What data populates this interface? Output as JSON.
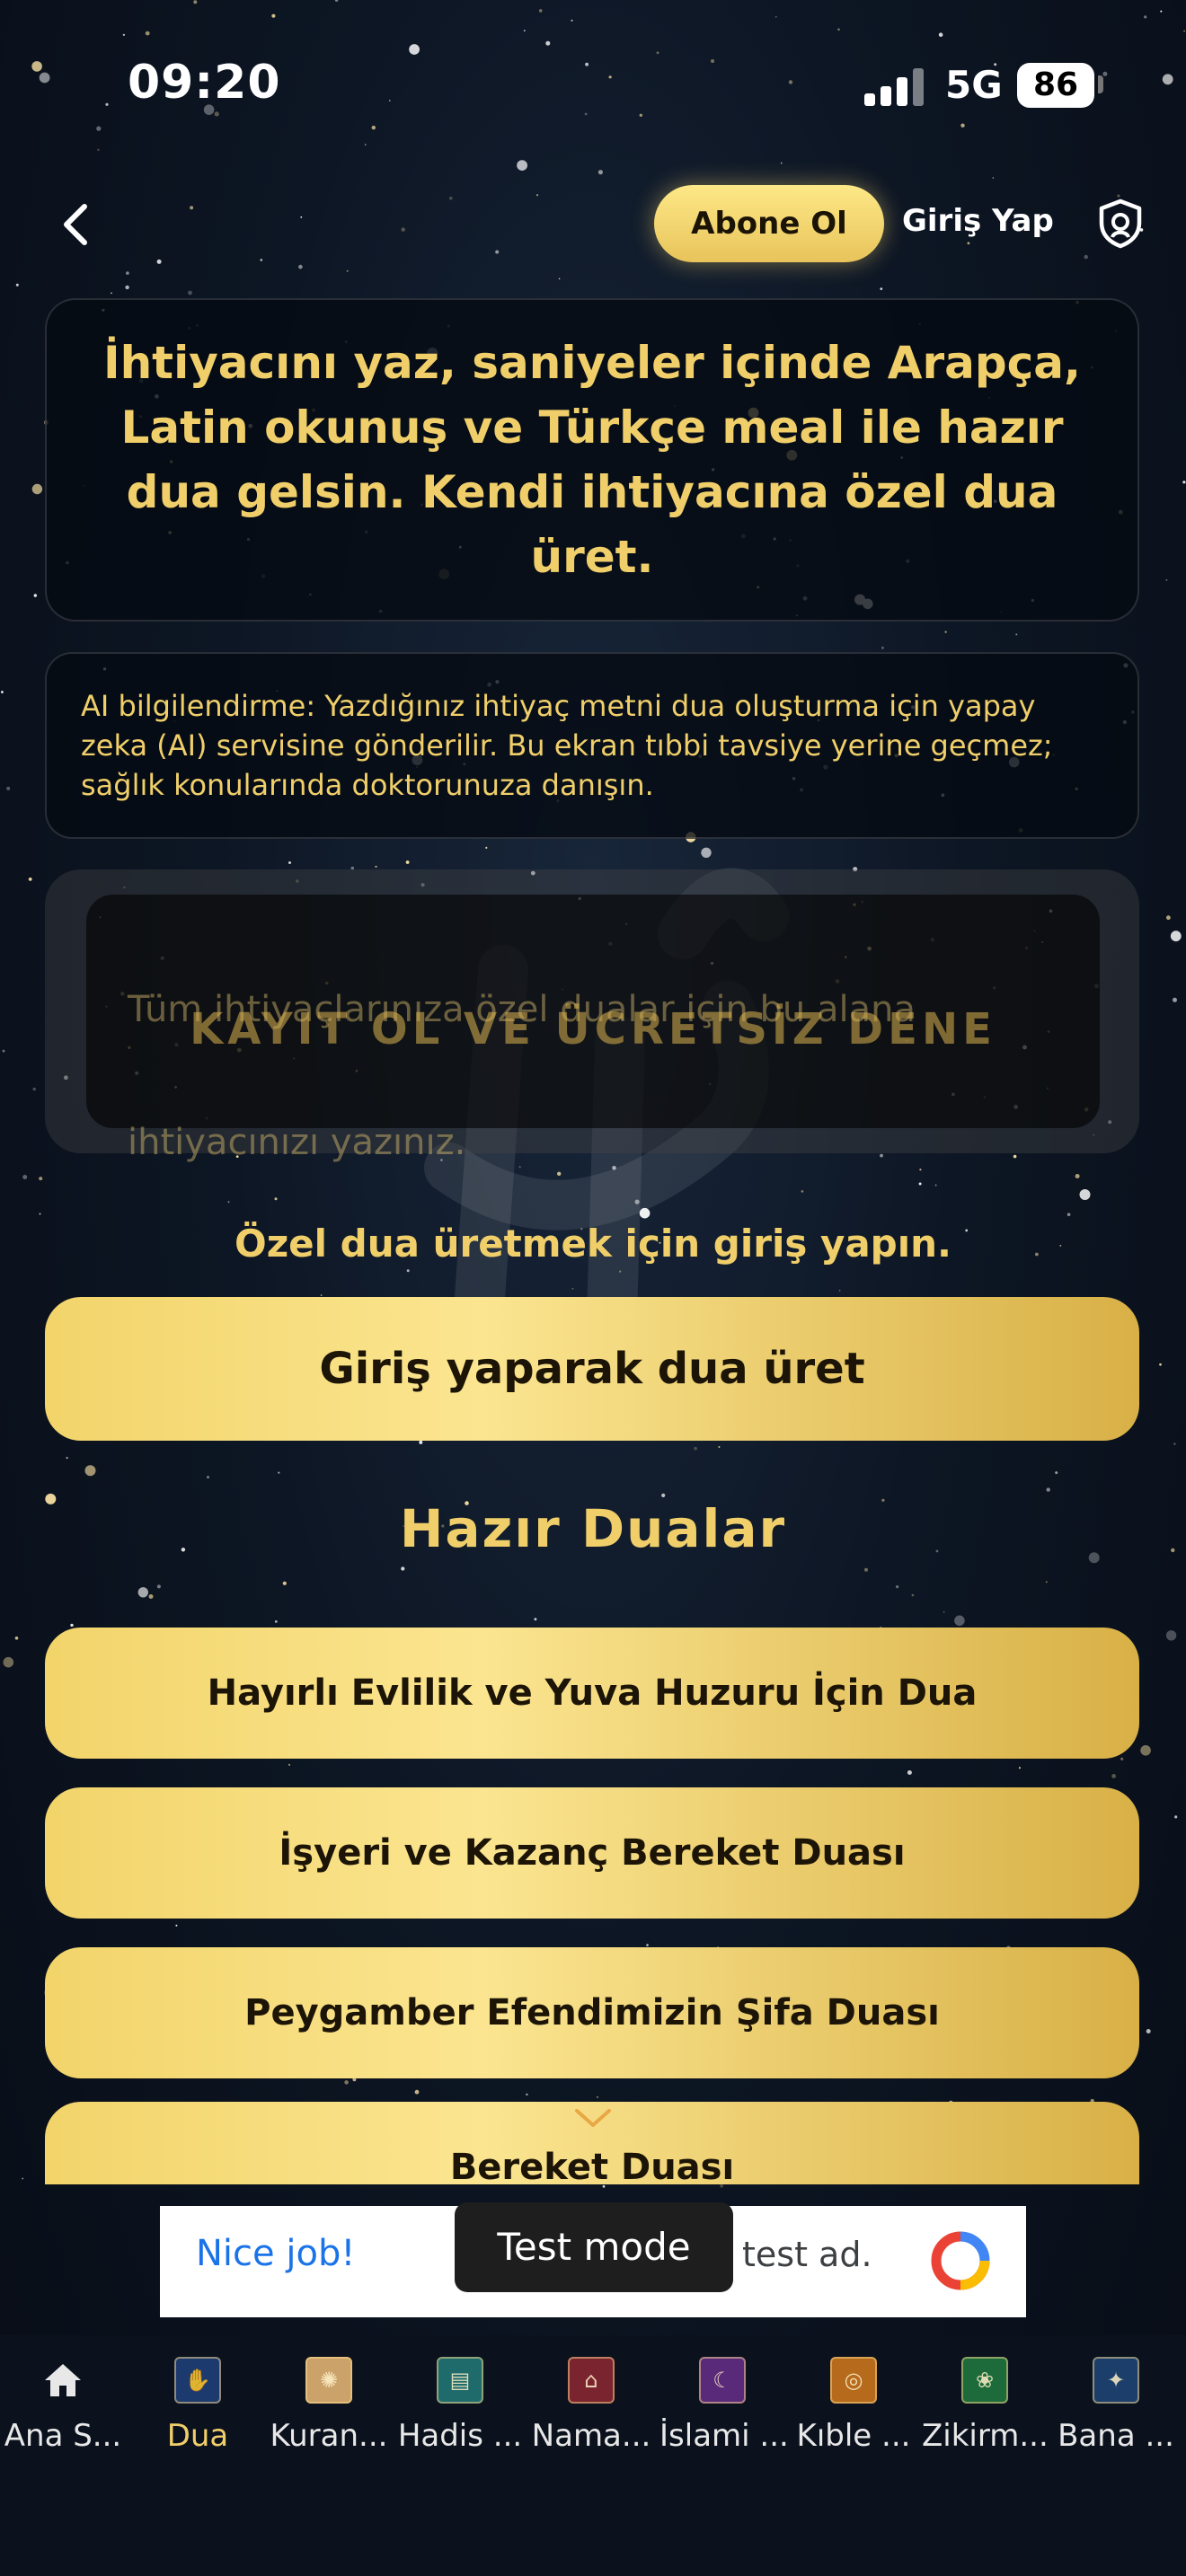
{
  "status": {
    "time": "09:20",
    "network": "5G",
    "battery": "86"
  },
  "header": {
    "subscribe_label": "Abone Ol",
    "login_label": "Giriş Yap"
  },
  "intro": {
    "text": "İhtiyacını yaz, saniyeler içinde Arapça, Latin okunuş ve Türkçe meal ile hazır dua gelsin. Kendi ihtiyacına özel dua üret."
  },
  "ai_notice": {
    "text": "AI bilgilendirme: Yazdığınız ihtiyaç metni dua oluşturma için yapay zeka (AI) servisine gönderilir. Bu ekran tıbbi tavsiye yerine geçmez; sağlık konularında doktorunuza danışın."
  },
  "input": {
    "placeholder": "Tüm ihtiyaçlarınıza özel dualar için bu alana ihtiyacınızı yazınız.",
    "overlay_cta": "KAYIT OL VE ÜCRETSİZ DENE"
  },
  "login_hint": "Özel dua üretmek için giriş yapın.",
  "login_button": "Giriş yaparak dua üret",
  "ready_prayers": {
    "title": "Hazır Dualar",
    "items": [
      "Hayırlı Evlilik ve Yuva Huzuru İçin Dua",
      "İşyeri ve Kazanç Bereket Duası",
      "Peygamber Efendimizin Şifa Duası",
      "Bereket Duası"
    ]
  },
  "ad": {
    "left_text": "Nice job!",
    "right_text": "test ad.",
    "test_mode": "Test mode"
  },
  "nav": {
    "items": [
      "Ana S...",
      "Dua",
      "Kuran...",
      "Hadis ...",
      "Nama...",
      "İslami ...",
      "Kıble ...",
      "Zikirm...",
      "Bana ..."
    ],
    "active": "Dua"
  },
  "colors": {
    "gold": "#f0cf6a",
    "button_gold": "#fbe590",
    "background": "#0d1624"
  }
}
